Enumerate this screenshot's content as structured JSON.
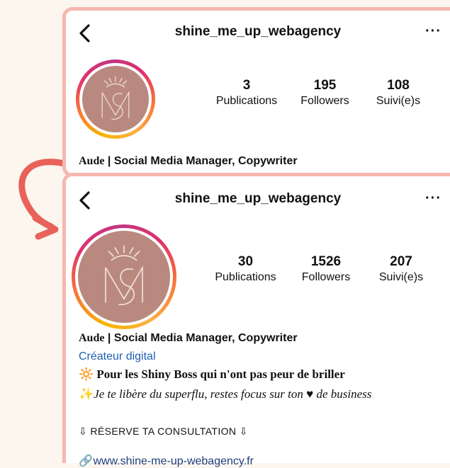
{
  "profile_old": {
    "username": "shine_me_up_webagency",
    "more": "···",
    "stats": [
      {
        "value": "3",
        "label": "Publications"
      },
      {
        "value": "195",
        "label": "Followers"
      },
      {
        "value": "108",
        "label": "Suivi(e)s"
      }
    ],
    "bio_name_first": "Aude",
    "bio_name_rest": " | Social Media Manager, Copywriter"
  },
  "profile_new": {
    "username": "shine_me_up_webagency",
    "more": "···",
    "stats": [
      {
        "value": "30",
        "label": "Publications"
      },
      {
        "value": "1526",
        "label": "Followers"
      },
      {
        "value": "207",
        "label": "Suivi(e)s"
      }
    ],
    "bio_name_first": "Aude",
    "bio_name_rest": " | Social Media Manager, Copywriter",
    "category": "Créateur digital",
    "bio_line1_emoji": "🔆",
    "bio_line1": " Pour les Shiny Boss qui n'ont pas peur de briller",
    "bio_line2_emoji": "✨",
    "bio_line2": "Je te libère du superflu, restes focus sur ton ♥ de business",
    "cta": "⇩ RÉSERVE TA CONSULTATION ⇩",
    "link": "www.shine-me-up-webagency.fr"
  },
  "colors": {
    "card_border": "#f5b8b0",
    "background": "#fcf6ee",
    "arrow": "#e8615a",
    "avatar_bg": "#b98980",
    "category_blue": "#1f5fb0"
  },
  "icons": {
    "back": "chevron-left-icon",
    "more": "more-horizontal-icon",
    "link": "link-icon"
  }
}
